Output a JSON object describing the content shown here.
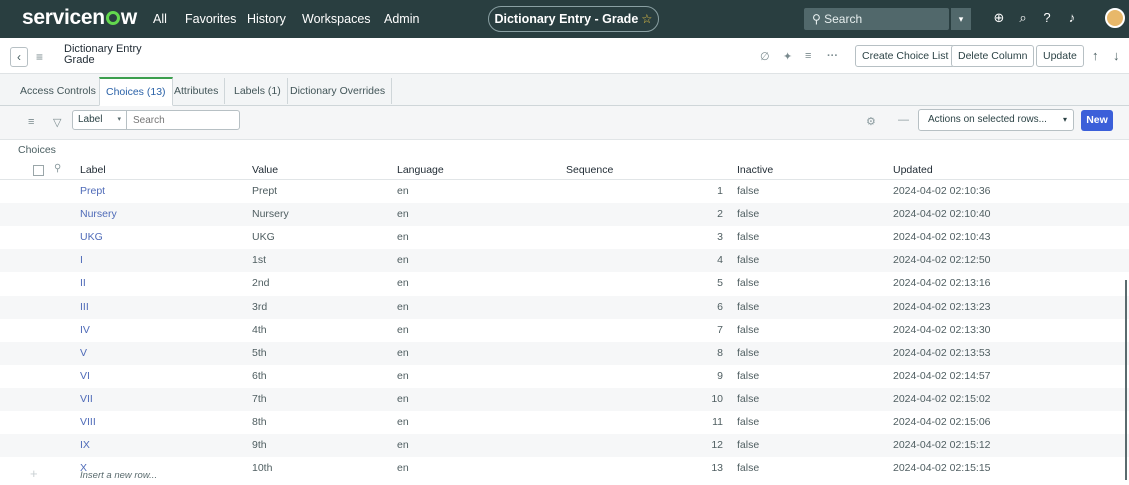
{
  "nav": {
    "brand": "servicenow",
    "brand_parts": {
      "pre": "servicen",
      "post": "w"
    },
    "links": [
      "All",
      "Favorites",
      "History",
      "Workspaces",
      "Admin"
    ],
    "context_pill": "Dictionary Entry - Grade",
    "search_placeholder": "Search"
  },
  "record": {
    "title_line1": "Dictionary Entry",
    "title_line2": "Grade",
    "buttons": {
      "create_choice_list": "Create Choice List",
      "delete_column": "Delete Column",
      "update": "Update"
    }
  },
  "tabs": [
    {
      "label": "Access Controls",
      "active": false
    },
    {
      "label": "Choices (13)",
      "active": true
    },
    {
      "label": "Attributes",
      "active": false
    },
    {
      "label": "Labels (1)",
      "active": false
    },
    {
      "label": "Dictionary Overrides",
      "active": false
    }
  ],
  "list_toolbar": {
    "field_select": "Label",
    "search_placeholder": "Search",
    "actions_select": "Actions on selected rows...",
    "new_button": "New"
  },
  "table": {
    "caption": "Choices",
    "columns": [
      "Label",
      "Value",
      "Language",
      "Sequence",
      "Inactive",
      "Updated"
    ],
    "rows": [
      {
        "label": "Prept",
        "value": "Prept",
        "language": "en",
        "sequence": "1",
        "inactive": "false",
        "updated": "2024-04-02 02:10:36"
      },
      {
        "label": "Nursery",
        "value": "Nursery",
        "language": "en",
        "sequence": "2",
        "inactive": "false",
        "updated": "2024-04-02 02:10:40"
      },
      {
        "label": "UKG",
        "value": "UKG",
        "language": "en",
        "sequence": "3",
        "inactive": "false",
        "updated": "2024-04-02 02:10:43"
      },
      {
        "label": "I",
        "value": "1st",
        "language": "en",
        "sequence": "4",
        "inactive": "false",
        "updated": "2024-04-02 02:12:50"
      },
      {
        "label": "II",
        "value": "2nd",
        "language": "en",
        "sequence": "5",
        "inactive": "false",
        "updated": "2024-04-02 02:13:16"
      },
      {
        "label": "III",
        "value": "3rd",
        "language": "en",
        "sequence": "6",
        "inactive": "false",
        "updated": "2024-04-02 02:13:23"
      },
      {
        "label": "IV",
        "value": "4th",
        "language": "en",
        "sequence": "7",
        "inactive": "false",
        "updated": "2024-04-02 02:13:30"
      },
      {
        "label": "V",
        "value": "5th",
        "language": "en",
        "sequence": "8",
        "inactive": "false",
        "updated": "2024-04-02 02:13:53"
      },
      {
        "label": "VI",
        "value": "6th",
        "language": "en",
        "sequence": "9",
        "inactive": "false",
        "updated": "2024-04-02 02:14:57"
      },
      {
        "label": "VII",
        "value": "7th",
        "language": "en",
        "sequence": "10",
        "inactive": "false",
        "updated": "2024-04-02 02:15:02"
      },
      {
        "label": "VIII",
        "value": "8th",
        "language": "en",
        "sequence": "11",
        "inactive": "false",
        "updated": "2024-04-02 02:15:06"
      },
      {
        "label": "IX",
        "value": "9th",
        "language": "en",
        "sequence": "12",
        "inactive": "false",
        "updated": "2024-04-02 02:15:12"
      },
      {
        "label": "X",
        "value": "10th",
        "language": "en",
        "sequence": "13",
        "inactive": "false",
        "updated": "2024-04-02 02:15:15"
      }
    ],
    "insert_row": "Insert a new row..."
  },
  "colors": {
    "nav_bg": "#293e40",
    "brand_accent": "#62d84e",
    "link": "#4f6bb8",
    "primary_button": "#3b5fd9"
  },
  "icons": [
    "search-icon",
    "globe-icon",
    "chat-icon",
    "help-icon",
    "bell-icon",
    "attachment-icon",
    "activity-icon",
    "settings-sliders-icon",
    "more-icon",
    "up-arrow-icon",
    "down-arrow-icon",
    "filter-icon",
    "gear-icon"
  ]
}
